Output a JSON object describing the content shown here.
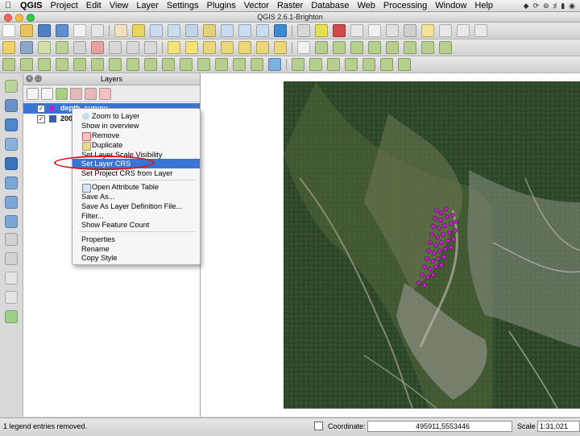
{
  "menubar": {
    "app": "QGIS",
    "items": [
      "Project",
      "Edit",
      "View",
      "Layer",
      "Settings",
      "Plugins",
      "Vector",
      "Raster",
      "Database",
      "Web",
      "Processing",
      "Window",
      "Help"
    ],
    "status_icons": [
      "dropbox-icon",
      "sync-icon",
      "bluetooth-icon",
      "volume-icon",
      "battery-icon",
      "wifi-icon"
    ]
  },
  "window": {
    "title": "QGIS 2.6.1-Brighton"
  },
  "layers_panel": {
    "title": "Layers",
    "layers": [
      {
        "name": "depth_survey",
        "checked": true,
        "selected": true
      },
      {
        "name": "200",
        "checked": true,
        "selected": false
      }
    ]
  },
  "context_menu": {
    "items": [
      {
        "label": "Zoom to Layer",
        "icon": "zoom-icon"
      },
      {
        "label": "Show in overview"
      },
      {
        "label": "Remove",
        "icon": "remove-icon"
      },
      {
        "label": "Duplicate",
        "icon": "duplicate-icon"
      },
      {
        "label": "Set Layer Scale Visibility"
      },
      {
        "label": "Set Layer CRS",
        "highlighted": true
      },
      {
        "label": "Set Project CRS from Layer"
      },
      {
        "label": "Open Attribute Table",
        "icon": "table-icon"
      },
      {
        "label": "Save As..."
      },
      {
        "label": "Save As Layer Definition File..."
      },
      {
        "label": "Filter..."
      },
      {
        "label": "Show Feature Count"
      },
      {
        "label": "Properties"
      },
      {
        "label": "Rename"
      },
      {
        "label": "Copy Style"
      }
    ]
  },
  "statusbar": {
    "message": "1 legend entries removed.",
    "coordinate_label": "Coordinate:",
    "coordinate_value": "495911,5553446",
    "scale_label": "Scale",
    "scale_value": "1:31,021"
  },
  "colors": {
    "selection": "#3875d7",
    "highlight_ring": "#d2141e",
    "points": "#c21fc4"
  }
}
